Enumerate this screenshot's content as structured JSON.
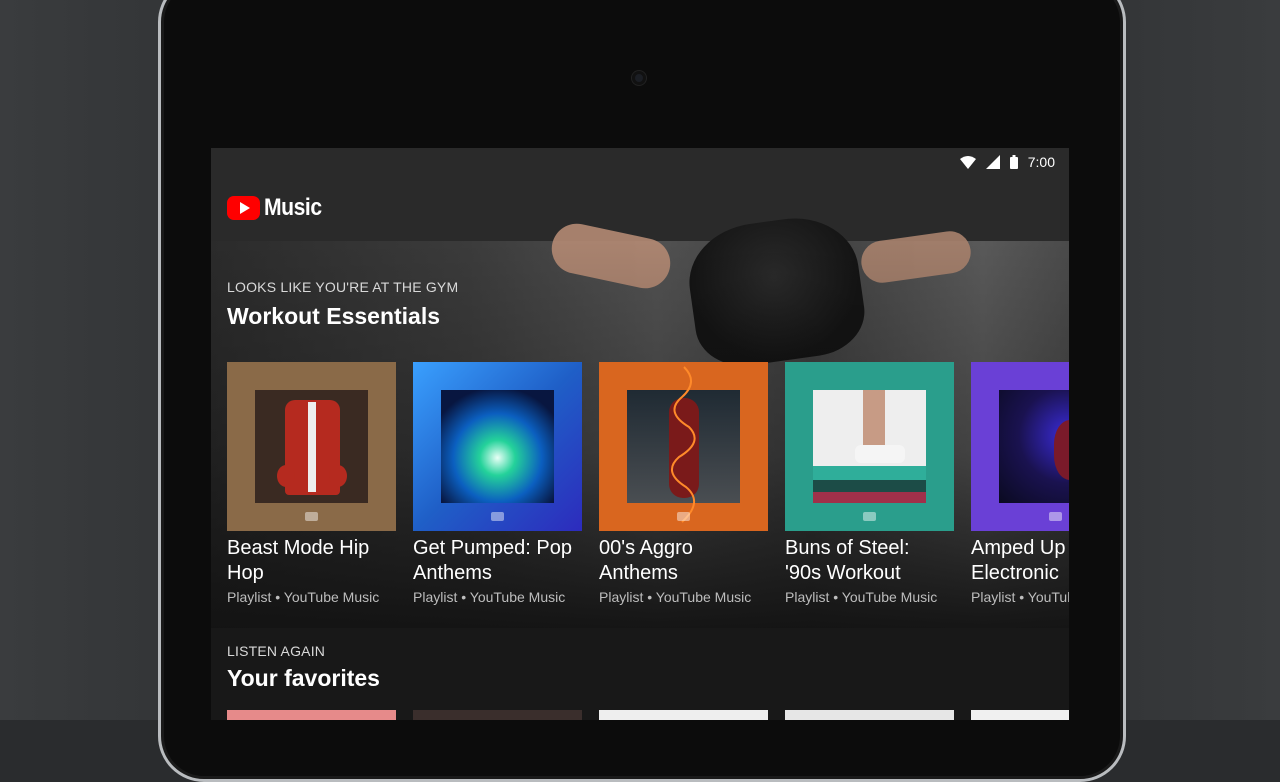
{
  "status_bar": {
    "time": "7:00"
  },
  "app": {
    "logo_text": "Music"
  },
  "hero_section": {
    "kicker": "LOOKS LIKE YOU'RE AT THE GYM",
    "title": "Workout Essentials",
    "cards": [
      {
        "title_line1": "Beast Mode Hip",
        "title_line2": "Hop",
        "subtitle": "Playlist • YouTube Music",
        "color": "#8a6a48",
        "inner": "#3a2a22"
      },
      {
        "title_line1": "Get Pumped: Pop",
        "title_line2": "Anthems",
        "subtitle": "Playlist • YouTube Music",
        "color": "#1f5fc7",
        "inner": "#103055"
      },
      {
        "title_line1": "00's Aggro",
        "title_line2": "Anthems",
        "subtitle": "Playlist • YouTube Music",
        "color": "#d9661f",
        "inner": "#2c3138"
      },
      {
        "title_line1": "Buns of Steel:",
        "title_line2": "'90s Workout",
        "subtitle": "Playlist • YouTube Music",
        "color": "#2a9e8c",
        "inner": "#e8e8e8"
      },
      {
        "title_line1": "Amped Up",
        "title_line2": "Electronic",
        "subtitle": "Playlist • YouTube Music",
        "color": "#6a40d6",
        "inner": "#0c1030"
      }
    ]
  },
  "section2": {
    "kicker": "LISTEN AGAIN",
    "title": "Your favorites",
    "thumbs": [
      "#e68a8a",
      "#3a2e2c",
      "#eeeeee",
      "#e6e6e6",
      "#f0f0f0"
    ]
  }
}
